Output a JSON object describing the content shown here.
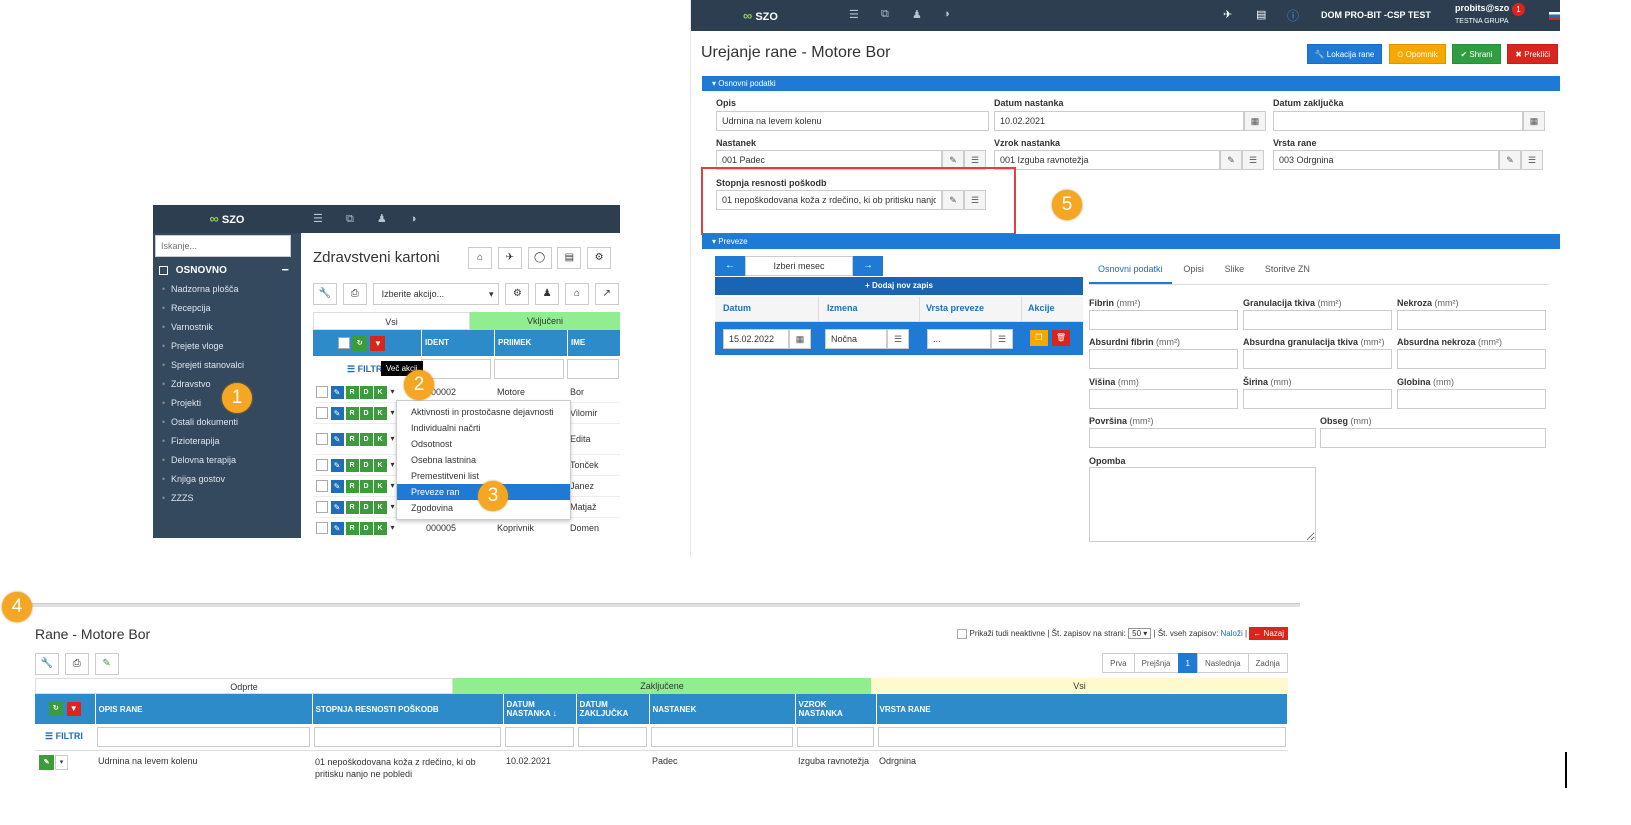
{
  "app": {
    "logo": "SZO"
  },
  "p1": {
    "search_placeholder": "Iskanje...",
    "section": "OSNOVNO",
    "nav": [
      "Nadzorna plošča",
      "Recepcija",
      "Varnostnik",
      "Prejete vloge",
      "Sprejeti stanovalci",
      "Zdravstvo",
      "Projekti",
      "Ostali dokumenti",
      "Fizioterapija",
      "Delovna terapija",
      "Knjiga gostov",
      "ZZZS"
    ],
    "title": "Zdravstveni kartoni",
    "action_select": "Izberite akcijo...",
    "tab_all": "Vsi",
    "tab_included": "Vključeni",
    "col_ident": "IDENT",
    "col_priimek": "PRIIMEK",
    "col_ime": "IME",
    "filtri": "FILTRI",
    "tooltip": "Več akcij",
    "rows": [
      {
        "ident": "000002",
        "priimek": "Motore",
        "ime": "Bor"
      },
      {
        "ident": "",
        "priimek": "",
        "ime": "Vilomir"
      },
      {
        "ident": "",
        "priimek": "",
        "ime": "Edita"
      },
      {
        "ident": "",
        "priimek": "",
        "ime": "Tonček"
      },
      {
        "ident": "",
        "priimek": "",
        "ime": "Janez"
      },
      {
        "ident": "",
        "priimek": "",
        "ime": "Matjaž"
      },
      {
        "ident": "000005",
        "priimek": "Koprivnik",
        "ime": "Domen"
      }
    ],
    "menu": [
      "Aktivnosti in prostočasne dejavnosti",
      "Individualni načrti",
      "Odsotnost",
      "Osebna lastnina",
      "Premestitveni list",
      "Preveze ran",
      "Zgodovina"
    ]
  },
  "p2": {
    "user": "probits@szo",
    "group": "TESTNA GRUPA",
    "org": "DOM PRO-BIT -CSP TEST",
    "notif": "1",
    "title": "Urejanje rane - Motore Bor",
    "btn_lok": "Lokacija rane",
    "btn_opom": "Opomnik",
    "btn_save": "Shrani",
    "btn_cancel": "Prekliči",
    "sec_basic": "Osnovni podatki",
    "l_opis": "Opis",
    "v_opis": "Udrnina na levem kolenu",
    "l_datum": "Datum nastanka",
    "v_datum": "10.02.2021",
    "l_zak": "Datum zaključka",
    "v_zak": "",
    "l_nast": "Nastanek",
    "v_nast": "001 Padec",
    "l_vzrok": "Vzrok nastanka",
    "v_vzrok": "001 Izguba ravnotežja",
    "l_vrsta": "Vrsta rane",
    "v_vrsta": "003 Odrgnina",
    "l_stop": "Stopnja resnosti poškodb",
    "v_stop": "01 nepoškodovana koža z rdečino, ki ob pritisku nanjo ne pobledi",
    "sec_prev": "Preveze",
    "month": "Izberi mesec",
    "add": "Dodaj nov zapis",
    "c_datum": "Datum",
    "c_izmena": "Izmena",
    "c_vrsta": "Vrsta preveze",
    "c_akcije": "Akcije",
    "r_datum": "15.02.2022",
    "r_izmena": "Nočna",
    "r_vrsta": "...",
    "tabs": [
      "Osnovni podatki",
      "Opisi",
      "Slike",
      "Storitve ZN"
    ],
    "f_fibrin": "Fibrin",
    "f_gran": "Granulacija tkiva",
    "f_nekr": "Nekroza",
    "f_afib": "Absurdni fibrin",
    "f_agran": "Absurdna granulacija tkiva",
    "f_anekr": "Absurdna nekroza",
    "u_mm2": "(mm²)",
    "u_mm": "(mm)",
    "f_vis": "Višina",
    "f_sir": "Širina",
    "f_glob": "Globina",
    "f_pov": "Površina",
    "f_obs": "Obseg",
    "f_opomba": "Opomba"
  },
  "p3": {
    "title": "Rane - Motore Bor",
    "show_inactive": "Prikaži tudi neaktivne | Št. zapisov na strani:",
    "per_page": "50",
    "total": "| Št. vseh zapisov:",
    "load": "Naloži",
    "sep": "|",
    "back": "Nazaj",
    "pages": {
      "first": "Prva",
      "prev": "Prejšnja",
      "cur": "1",
      "next": "Naslednja",
      "last": "Zadnja"
    },
    "tabs": [
      "Odprte",
      "Zaključene",
      "Vsi"
    ],
    "cols": [
      "OPIS RANE",
      "STOPNJA RESNOSTI POŠKODB",
      "DATUM NASTANKA",
      "DATUM ZAKLJUČKA",
      "NASTANEK",
      "VZROK NASTANKA",
      "VRSTA RANE"
    ],
    "filtri": "FILTRI",
    "row": {
      "opis": "Udrnina na levem kolenu",
      "stopnja": "01 nepoškodovana koža z rdečino, ki ob pritisku nanjo ne pobledi",
      "datum": "10.02.2021",
      "zak": "",
      "nast": "Padec",
      "vzrok": "Izguba ravnotežja",
      "vrsta": "Odrgnina"
    }
  },
  "badges": [
    "1",
    "2",
    "3",
    "4",
    "5"
  ],
  "colors": {
    "dark": "#2c3e50",
    "blue": "#2d8bc9",
    "green": "#90ee90",
    "yellow": "#fffacd",
    "badge": "#f5a623",
    "red": "#d9251c"
  }
}
